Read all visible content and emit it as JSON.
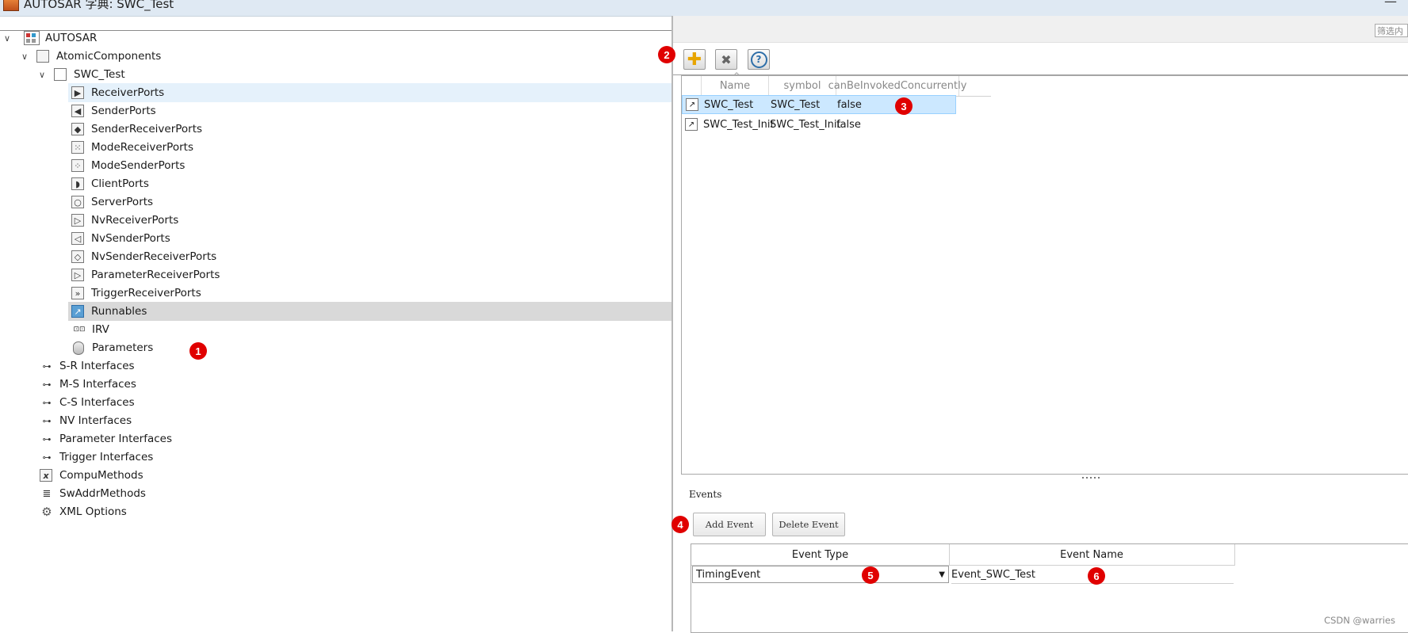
{
  "window": {
    "title": "AUTOSAR 字典: SWC_Test",
    "minimize_glyph": "—"
  },
  "tree": {
    "items": [
      {
        "label": "AUTOSAR",
        "icon": "autosar-grid-icon",
        "expanded": true
      },
      {
        "label": "AtomicComponents",
        "icon": "folder-box-icon",
        "expanded": true
      },
      {
        "label": "SWC_Test",
        "icon": "component-box-icon",
        "expanded": true
      },
      {
        "label": "ReceiverPorts",
        "icon": "receiver-port-icon",
        "glyph": "▶"
      },
      {
        "label": "SenderPorts",
        "icon": "sender-port-icon",
        "glyph": "◀"
      },
      {
        "label": "SenderReceiverPorts",
        "icon": "sender-receiver-port-icon",
        "glyph": "◆"
      },
      {
        "label": "ModeReceiverPorts",
        "icon": "mode-receiver-port-icon",
        "glyph": "⁙"
      },
      {
        "label": "ModeSenderPorts",
        "icon": "mode-sender-port-icon",
        "glyph": "⁘"
      },
      {
        "label": "ClientPorts",
        "icon": "client-port-icon",
        "glyph": "◗"
      },
      {
        "label": "ServerPorts",
        "icon": "server-port-icon",
        "glyph": "○"
      },
      {
        "label": "NvReceiverPorts",
        "icon": "nv-receiver-port-icon",
        "glyph": "▷"
      },
      {
        "label": "NvSenderPorts",
        "icon": "nv-sender-port-icon",
        "glyph": "◁"
      },
      {
        "label": "NvSenderReceiverPorts",
        "icon": "nv-sender-receiver-port-icon",
        "glyph": "◇"
      },
      {
        "label": "ParameterReceiverPorts",
        "icon": "parameter-receiver-port-icon",
        "glyph": "▷"
      },
      {
        "label": "TriggerReceiverPorts",
        "icon": "trigger-receiver-port-icon",
        "glyph": "»"
      },
      {
        "label": "Runnables",
        "icon": "runnable-icon",
        "glyph": "↗"
      },
      {
        "label": "IRV",
        "icon": "irv-icon",
        "glyph": "⊡⊡"
      },
      {
        "label": "Parameters",
        "icon": "database-icon"
      },
      {
        "label": "S-R Interfaces",
        "icon": "interface-icon",
        "glyph": "⊶"
      },
      {
        "label": "M-S Interfaces",
        "icon": "interface-icon",
        "glyph": "⊶"
      },
      {
        "label": "C-S Interfaces",
        "icon": "interface-icon",
        "glyph": "⊶"
      },
      {
        "label": "NV Interfaces",
        "icon": "interface-icon",
        "glyph": "⊶"
      },
      {
        "label": "Parameter Interfaces",
        "icon": "interface-icon",
        "glyph": "⊶"
      },
      {
        "label": "Trigger Interfaces",
        "icon": "interface-icon",
        "glyph": "⊶"
      },
      {
        "label": "CompuMethods",
        "icon": "compu-method-icon",
        "glyph": "x"
      },
      {
        "label": "SwAddrMethods",
        "icon": "sw-addr-method-icon",
        "glyph": "≣"
      },
      {
        "label": "XML Options",
        "icon": "gear-icon",
        "glyph": "⚙"
      }
    ]
  },
  "filter": {
    "placeholder": "筛选内"
  },
  "toolbar": {
    "add_glyph": "✚",
    "delete_glyph": "✖",
    "help_glyph": "?"
  },
  "runnables_table": {
    "columns": [
      "Name",
      "symbol",
      "canBeInvokedConcurrently"
    ],
    "sort_glyph": "^",
    "row_glyph": "↗",
    "rows": [
      {
        "name": "SWC_Test",
        "symbol": "SWC_Test",
        "concurrent": "false"
      },
      {
        "name": "SWC_Test_Init",
        "symbol": "SWC_Test_Init",
        "concurrent": "false"
      }
    ]
  },
  "events": {
    "label": "Events",
    "add_label": "Add Event",
    "delete_label": "Delete Event",
    "columns": [
      "Event Type",
      "Event Name"
    ],
    "row": {
      "type": "TimingEvent",
      "name": "Event_SWC_Test"
    },
    "dropdown_glyph": "▼"
  },
  "annotations": [
    "1",
    "2",
    "3",
    "4",
    "5",
    "6"
  ],
  "watermark": "CSDN @warries",
  "colors": {
    "badge": "#e00000",
    "selection": "#cce8ff",
    "tree_selected": "#e5f1fb",
    "tree_hilite": "#d9d9d9"
  }
}
